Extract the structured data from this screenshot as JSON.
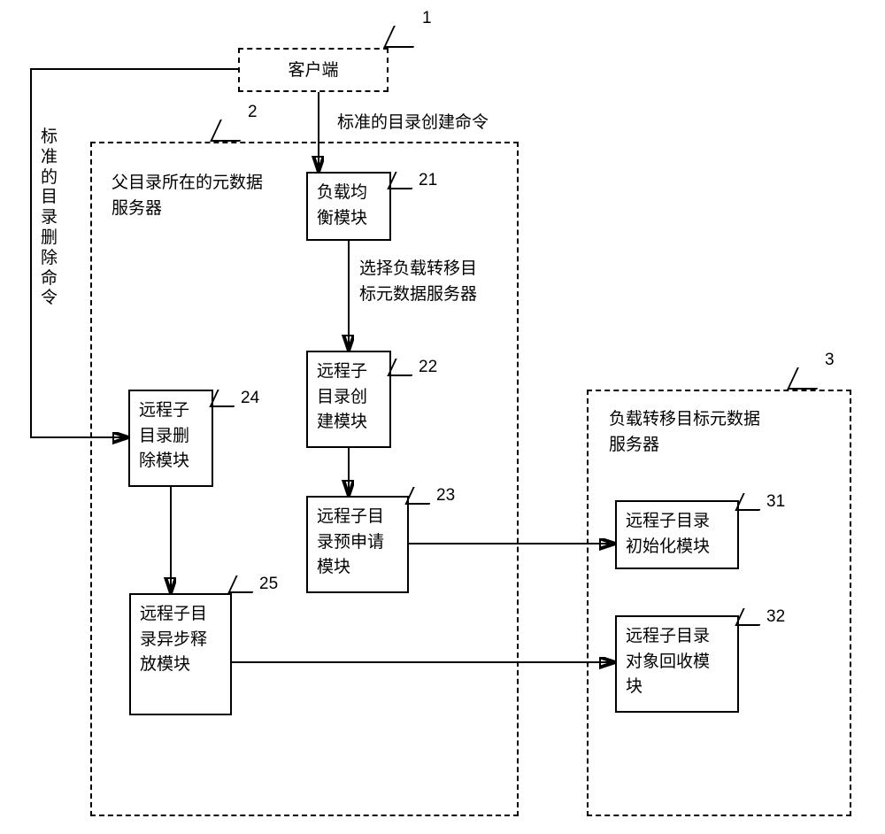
{
  "box1": {
    "label": "客户端",
    "num": "1"
  },
  "box2": {
    "title_l1": "父目录所在的元数据",
    "title_l2": "服务器",
    "num": "2"
  },
  "box3": {
    "title_l1": "负载转移目标元数据",
    "title_l2": "服务器",
    "num": "3"
  },
  "b21": {
    "l1": "负载均",
    "l2": "衡模块",
    "num": "21"
  },
  "b22": {
    "l1": "远程子",
    "l2": "目录创",
    "l3": "建模块",
    "num": "22"
  },
  "b23": {
    "l1": "远程子目",
    "l2": "录预申请",
    "l3": "模块",
    "num": "23"
  },
  "b24": {
    "l1": "远程子",
    "l2": "目录删",
    "l3": "除模块",
    "num": "24"
  },
  "b25": {
    "l1": "远程子目",
    "l2": "录异步释",
    "l3": "放模块",
    "num": "25"
  },
  "b31": {
    "l1": "远程子目录",
    "l2": "初始化模块",
    "num": "31"
  },
  "b32": {
    "l1": "远程子目录",
    "l2": "对象回收模",
    "l3": "块",
    "num": "32"
  },
  "edge1": "标准的目录创建命令",
  "edge2_l1": "选择负载转移目",
  "edge2_l2": "标元数据服务器",
  "edge3_chars": [
    "标",
    "准",
    "的",
    "目",
    "录",
    "删",
    "除",
    "命",
    "令"
  ]
}
